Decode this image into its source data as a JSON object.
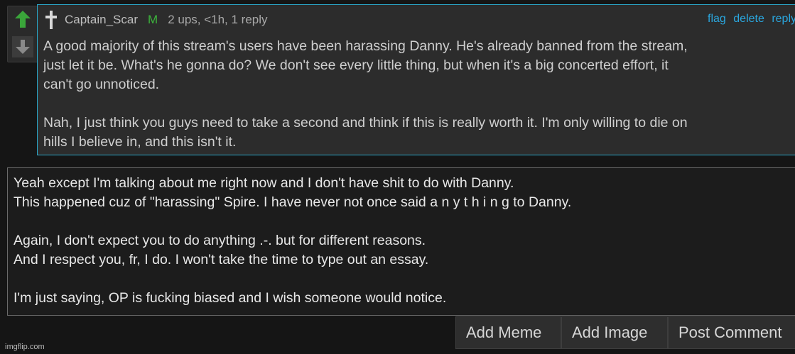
{
  "comment": {
    "username": "Captain_Scar",
    "badge": "M",
    "meta": "2 ups, <1h, 1 reply",
    "actions": [
      "flag",
      "delete",
      "reply"
    ],
    "text": "A good majority of this stream's users have been harassing Danny. He's already banned from the stream,\njust let it be. What's he gonna do? We don't see every little thing, but when it's a big concerted effort, it\ncan't go unnoticed.\n\nNah, I just think you guys need to take a second and think if this is really worth it. I'm only willing to die on\nhills I believe in, and this isn't it."
  },
  "reply_box": {
    "value": "Yeah except I'm talking about me right now and I don't have shit to do with Danny.\nThis happened cuz of \"harassing\" Spire. I have never not once said a n y t h i n g to Danny.\n\nAgain, I don't expect you to do anything .-. but for different reasons.\nAnd I respect you, fr, I do. I won't take the time to type out an essay.\n\nI'm just saying, OP is fucking biased and I wish someone would notice."
  },
  "buttons": {
    "add_meme": "Add Meme",
    "add_image": "Add Image",
    "post_comment": "Post Comment"
  },
  "watermark": "imgflip.com",
  "icons": {
    "upvote": "arrow-up-icon",
    "downvote": "arrow-down-icon",
    "cross": "cross-icon"
  },
  "colors": {
    "upvote_active": "#3aa53a",
    "link": "#2aa7df",
    "border_accent": "#2aa7c9",
    "mod_badge": "#3cb43c"
  }
}
